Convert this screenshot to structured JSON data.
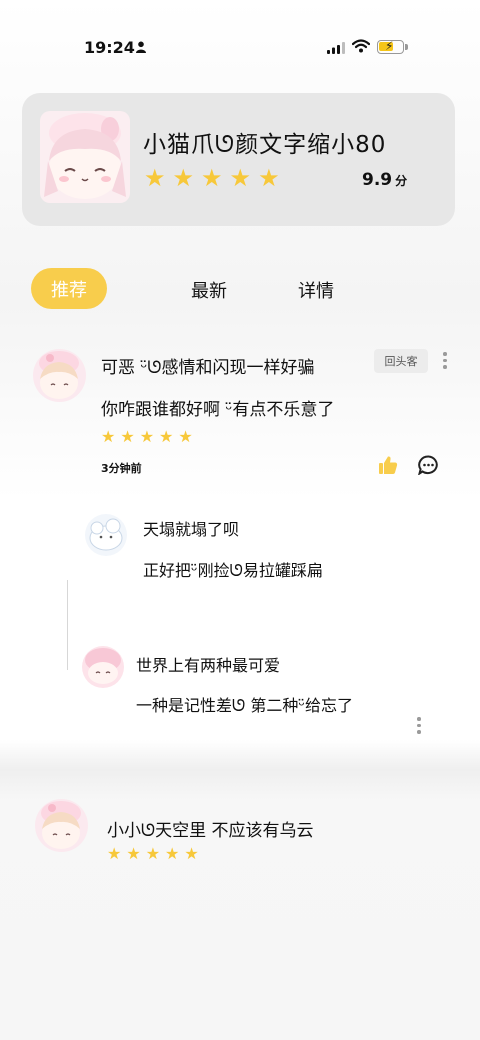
{
  "status_bar": {
    "time": "19:24"
  },
  "header": {
    "title": "小猫爪ᘎ颜文字缩小80",
    "rating_stars": 5,
    "score": "9.9",
    "score_unit": "分"
  },
  "tabs": [
    {
      "label": "推荐",
      "active": true
    },
    {
      "label": "最新",
      "active": false
    },
    {
      "label": "详情",
      "active": false
    }
  ],
  "comments": [
    {
      "line1": "可恶 ᵕ̈ᘎ感情和闪现一样好骗",
      "badge": "回头客",
      "line2": "你咋跟谁都好啊 ᵕ̈有点不乐意了",
      "stars": 5,
      "time": "3分钟前",
      "replies": [
        {
          "line1": "天塌就塌了呗",
          "line2": "正好把ᵕ̈刚捡ᘎ易拉罐踩扁"
        },
        {
          "line1": "世界上有两种最可爱",
          "line2": "一种是记性差ᘎ 第二种ᵕ̈给忘了"
        }
      ]
    },
    {
      "line1": "小小ᘎ天空里 不应该有乌云",
      "stars": 5
    }
  ],
  "colors": {
    "accent": "#f8cd4c",
    "star": "#f7c83a",
    "card_bg": "#e7e7e7"
  }
}
